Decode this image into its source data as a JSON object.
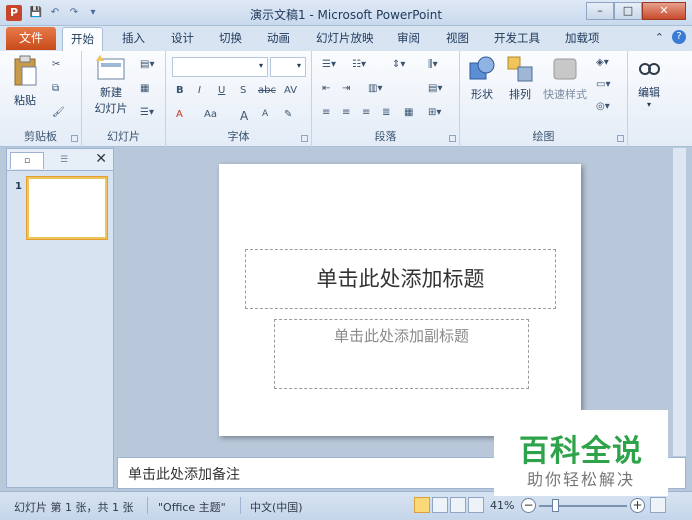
{
  "window": {
    "title": "演示文稿1 - Microsoft PowerPoint",
    "app_icon_letter": "P"
  },
  "ribbon_tabs": {
    "file": "文件",
    "items": [
      "开始",
      "插入",
      "设计",
      "切换",
      "动画",
      "幻灯片放映",
      "审阅",
      "视图",
      "开发工具",
      "加载项"
    ],
    "active": "开始"
  },
  "ribbon": {
    "clipboard": {
      "paste": "粘贴",
      "label": "剪贴板"
    },
    "slides": {
      "new_slide_line1": "新建",
      "new_slide_line2": "幻灯片",
      "label": "幻灯片"
    },
    "font": {
      "label": "字体",
      "bold": "B",
      "italic": "I",
      "underline": "U",
      "shadow": "S",
      "strike": "abc",
      "spacing": "AV",
      "color": "A",
      "case": "Aa",
      "grow": "A",
      "shrink": "A"
    },
    "paragraph": {
      "label": "段落"
    },
    "drawing": {
      "shapes": "形状",
      "arrange": "排列",
      "quick_styles": "快速样式",
      "label": "绘图"
    },
    "editing": {
      "edit": "编辑"
    }
  },
  "slides_pane": {
    "slide_number": "1"
  },
  "slide": {
    "title_placeholder": "单击此处添加标题",
    "subtitle_placeholder": "单击此处添加副标题"
  },
  "notes": {
    "placeholder": "单击此处添加备注"
  },
  "status_bar": {
    "slide_info": "幻灯片 第 1 张，共 1 张",
    "theme": "\"Office 主题\"",
    "language": "中文(中国)",
    "zoom": "41%"
  },
  "watermark": {
    "line1": "百科全说",
    "line2": "助你轻松解决"
  },
  "colors": {
    "file_tab": "#c84a1a",
    "accent": "#2ea34a",
    "selection": "#f2c45c"
  }
}
